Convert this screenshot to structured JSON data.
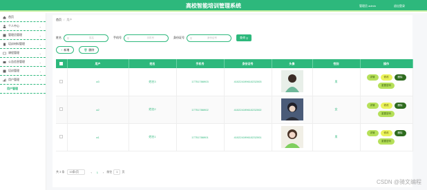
{
  "header": {
    "title": "高校智能培训管理系统",
    "user": "管理员 admin",
    "logout": "退出登录"
  },
  "sidebar": {
    "items": [
      {
        "label": "首页",
        "icon": "home-icon"
      },
      {
        "label": "个人中心",
        "icon": "user-icon"
      },
      {
        "label": "管理员管理",
        "icon": "admin-icon"
      },
      {
        "label": "培训材料管理",
        "icon": "doc-icon"
      },
      {
        "label": "课程管理",
        "icon": "course-icon"
      },
      {
        "label": "公告信息管理",
        "icon": "notice-icon"
      },
      {
        "label": "培训管理",
        "icon": "train-icon"
      },
      {
        "label": "用户管理",
        "icon": "users-icon"
      }
    ],
    "sub_item": "用户管理"
  },
  "breadcrumb": {
    "home": "首页",
    "separator": "/",
    "current": "用户"
  },
  "search": {
    "field1_label": "姓名",
    "field1_placeholder": "姓名",
    "field2_label": "手机号",
    "field2_placeholder": "手机号",
    "field3_label": "身份证号",
    "field3_placeholder": "身份证号",
    "button": "查询"
  },
  "actions": {
    "add": "新增",
    "delete": "删除"
  },
  "table": {
    "headers": [
      "用户",
      "姓名",
      "手机号",
      "身份证号",
      "头像",
      "性别",
      "操作"
    ],
    "rows": [
      {
        "user": "a3",
        "name": "姓名3",
        "phone": "17751786903",
        "idcard": "410224199610232003",
        "gender": "男"
      },
      {
        "user": "a2",
        "name": "姓名2",
        "phone": "17751786902",
        "idcard": "410224199610232002",
        "gender": "女"
      },
      {
        "user": "a1",
        "name": "姓名1",
        "phone": "17751786901",
        "idcard": "410224199610232001",
        "gender": "男"
      }
    ],
    "ops": {
      "detail": "详情",
      "edit": "修改",
      "del": "删除",
      "pwd": "重置密码"
    }
  },
  "pager": {
    "total": "共 3 条",
    "size": "10条/页",
    "prev": "‹",
    "page": "1",
    "next": "›",
    "goto": "前往",
    "goto_value": "1",
    "page_unit": "页"
  },
  "watermark": "CSDN @骑文编程",
  "colors": {
    "accent": "#2db87c",
    "detail": "#b6e05a",
    "edit": "#eaf25a",
    "delete": "#2e6b1e"
  }
}
